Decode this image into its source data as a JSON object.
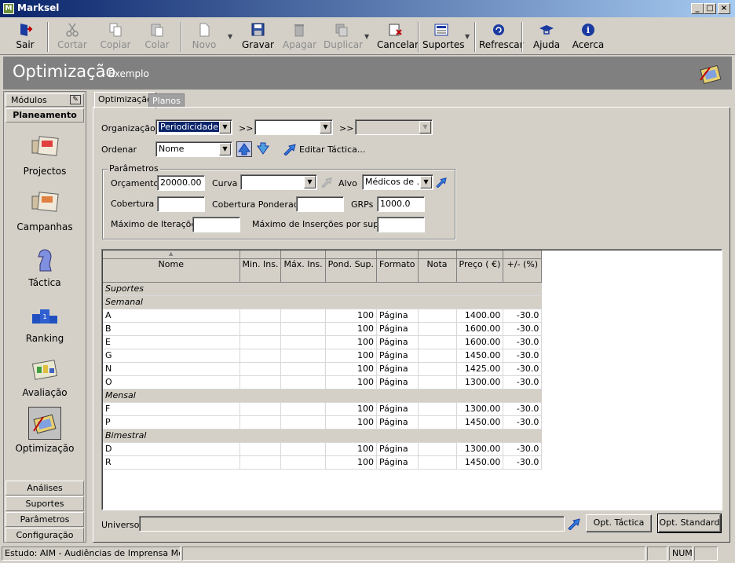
{
  "window": {
    "title": "Marksel",
    "app_icon": "M"
  },
  "toolbar": {
    "sair": "Sair",
    "cortar": "Cortar",
    "copiar": "Copiar",
    "colar": "Colar",
    "novo": "Novo",
    "gravar": "Gravar",
    "apagar": "Apagar",
    "duplicar": "Duplicar",
    "cancelar": "Cancelar",
    "suportes": "Suportes",
    "refrescar": "Refrescar",
    "ajuda": "Ajuda",
    "acerca": "Acerca"
  },
  "header": {
    "title": "Optimização",
    "subtitle": "- Exemplo"
  },
  "sidebar": {
    "modules_label": "Módulos",
    "section": "Planeamento",
    "items": [
      {
        "label": "Projectos"
      },
      {
        "label": "Campanhas"
      },
      {
        "label": "Táctica"
      },
      {
        "label": "Ranking"
      },
      {
        "label": "Avaliação"
      },
      {
        "label": "Optimização"
      }
    ],
    "bottom": [
      "Análises",
      "Suportes",
      "Parâmetros",
      "Configuração"
    ]
  },
  "tabs": [
    {
      "label": "Optimização"
    },
    {
      "label": "Planos"
    }
  ],
  "form": {
    "organizacao_label": "Organização",
    "organizacao_value": "Periodicidade",
    "sep1": ">>",
    "combo2_value": "",
    "sep2": ">>",
    "combo3_value": "",
    "ordenar_label": "Ordenar",
    "ordenar_value": "Nome",
    "editar_tactica": "Editar Táctica...",
    "parametros_title": "Parâmetros",
    "orcamento_label": "Orçamento",
    "orcamento_value": "20000.00",
    "curva_label": "Curva",
    "curva_value": "",
    "alvo_label": "Alvo",
    "alvo_value": "Médicos de ...",
    "cobertura_label": "Cobertura",
    "cobertura_value": "",
    "cob_pond_label": "Cobertura Ponderada",
    "cob_pond_value": "",
    "grps_label": "GRPs",
    "grps_value": "1000.0",
    "max_iter_label": "Máximo de Iterações",
    "max_iter_value": "",
    "max_ins_label": "Máximo de Inserções por suporte",
    "max_ins_value": ""
  },
  "grid": {
    "columns": [
      "Nome",
      "Min. Ins.",
      "Máx. Ins.",
      "Pond. Sup.",
      "Formato",
      "Nota",
      "Preço ( €)",
      "+/- (%)"
    ],
    "groups": [
      {
        "label": "Suportes",
        "rows": []
      },
      {
        "label": "Semanal",
        "rows": [
          {
            "nome": "A",
            "pond": "100",
            "formato": "Página",
            "preco": "1400.00",
            "var": "-30.0"
          },
          {
            "nome": "B",
            "pond": "100",
            "formato": "Página",
            "preco": "1600.00",
            "var": "-30.0"
          },
          {
            "nome": "E",
            "pond": "100",
            "formato": "Página",
            "preco": "1600.00",
            "var": "-30.0"
          },
          {
            "nome": "G",
            "pond": "100",
            "formato": "Página",
            "preco": "1450.00",
            "var": "-30.0"
          },
          {
            "nome": "N",
            "pond": "100",
            "formato": "Página",
            "preco": "1425.00",
            "var": "-30.0"
          },
          {
            "nome": "O",
            "pond": "100",
            "formato": "Página",
            "preco": "1300.00",
            "var": "-30.0"
          }
        ]
      },
      {
        "label": "Mensal",
        "rows": [
          {
            "nome": "F",
            "pond": "100",
            "formato": "Página",
            "preco": "1300.00",
            "var": "-30.0"
          },
          {
            "nome": "P",
            "pond": "100",
            "formato": "Página",
            "preco": "1450.00",
            "var": "-30.0"
          }
        ]
      },
      {
        "label": "Bimestral",
        "rows": [
          {
            "nome": "D",
            "pond": "100",
            "formato": "Página",
            "preco": "1300.00",
            "var": "-30.0"
          },
          {
            "nome": "R",
            "pond": "100",
            "formato": "Página",
            "preco": "1450.00",
            "var": "-30.0"
          }
        ]
      }
    ]
  },
  "bottom": {
    "universo_label": "Universo",
    "universo_value": "",
    "opt_tactica": "Opt. Táctica",
    "opt_standard": "Opt. Standard"
  },
  "statusbar": {
    "estudo": "Estudo: AIM - Audiências de Imprensa Médica",
    "num": "NUM"
  }
}
